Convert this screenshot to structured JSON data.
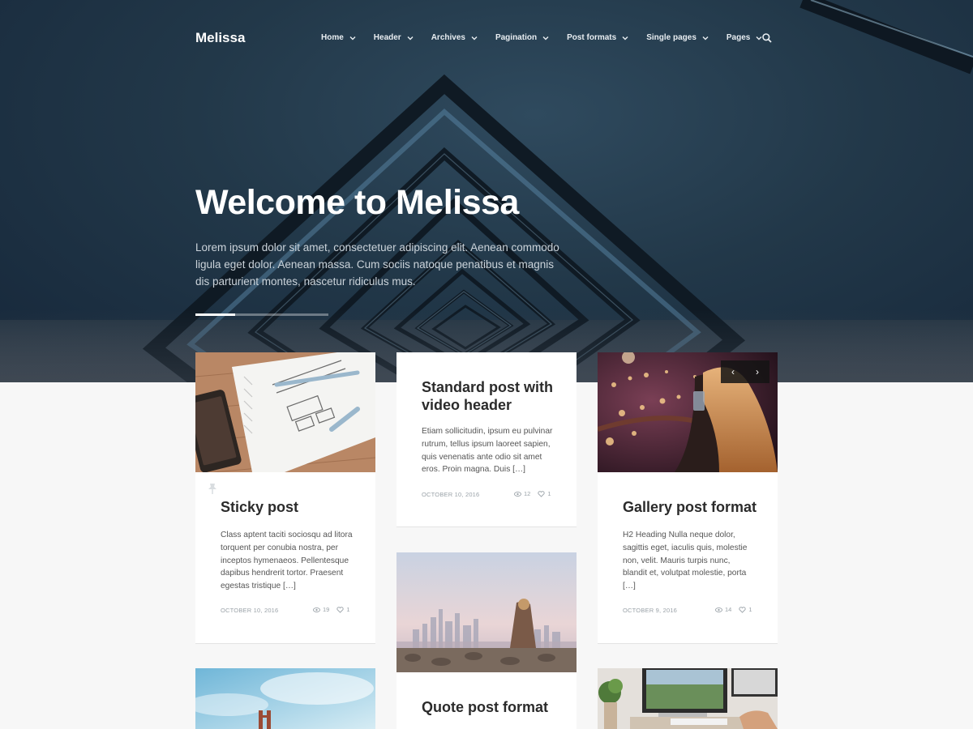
{
  "site": {
    "logo": "Melissa"
  },
  "nav": {
    "items": [
      {
        "label": "Home"
      },
      {
        "label": "Header"
      },
      {
        "label": "Archives"
      },
      {
        "label": "Pagination"
      },
      {
        "label": "Post formats"
      },
      {
        "label": "Single pages"
      },
      {
        "label": "Pages"
      }
    ],
    "search_icon": "search-icon"
  },
  "hero": {
    "title": "Welcome to Melissa",
    "text": "Lorem ipsum dolor sit amet, consectetuer adipiscing elit. Aenean commodo ligula eget dolor. Aenean massa. Cum sociis natoque penatibus et magnis dis parturient montes, nascetur ridiculus mus.",
    "slider_progress": 0.3
  },
  "posts": [
    {
      "title": "Sticky post",
      "excerpt": "Class aptent taciti sociosqu ad litora torquent per conubia nostra, per inceptos hymenaeos. Pellentesque dapibus hendrerit tortor. Praesent egestas tristique […]",
      "date": "OCTOBER 10, 2016",
      "views": "19",
      "likes": "1",
      "icon": "pin-icon"
    },
    {
      "title": "Standard post with video header",
      "excerpt": "Etiam sollicitudin, ipsum eu pulvinar rutrum, tellus ipsum laoreet sapien, quis venenatis ante odio sit amet eros. Proin magna. Duis […]",
      "date": "OCTOBER 10, 2016",
      "views": "12",
      "likes": "1"
    },
    {
      "title": "Gallery post format",
      "excerpt": "H2 Heading Nulla neque dolor, sagittis eget, iaculis quis, molestie non, velit. Mauris turpis nunc, blandit et, volutpat molestie, porta […]",
      "date": "OCTOBER 9, 2016",
      "views": "14",
      "likes": "1",
      "gallery_prev": "‹",
      "gallery_next": "›"
    },
    {
      "title": "Quote post format"
    }
  ],
  "colors": {
    "hero_bg": "#223849",
    "page_bg": "#f7f7f7",
    "card_bg": "#ffffff",
    "meta": "#9aa2a8"
  }
}
